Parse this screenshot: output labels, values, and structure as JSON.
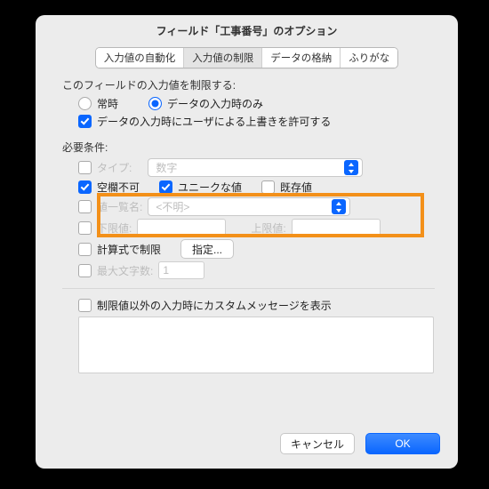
{
  "title": "フィールド「工事番号」のオプション",
  "tabs": {
    "auto": "入力値の自動化",
    "validate": "入力値の制限",
    "storage": "データの格納",
    "furigana": "ふりがな"
  },
  "section1": {
    "heading": "このフィールドの入力値を制限する:",
    "always": "常時",
    "only_on_entry": "データの入力時のみ",
    "allow_override": "データの入力時にユーザによる上書きを許可する"
  },
  "section2": {
    "heading": "必要条件:",
    "type_label": "タイプ:",
    "type_value": "数字",
    "not_empty": "空欄不可",
    "unique": "ユニークな値",
    "existing": "既存値",
    "from_label": "値一覧名:",
    "from_value": "<不明>",
    "lower_label": "下限値:",
    "upper_label": "上限値:",
    "calc_label": "計算式で制限",
    "specify_btn": "指定...",
    "maxlen_label": "最大文字数:",
    "maxlen_value": "1"
  },
  "section3": {
    "custom_msg_label": "制限値以外の入力時にカスタムメッセージを表示"
  },
  "footer": {
    "cancel": "キャンセル",
    "ok": "OK"
  }
}
